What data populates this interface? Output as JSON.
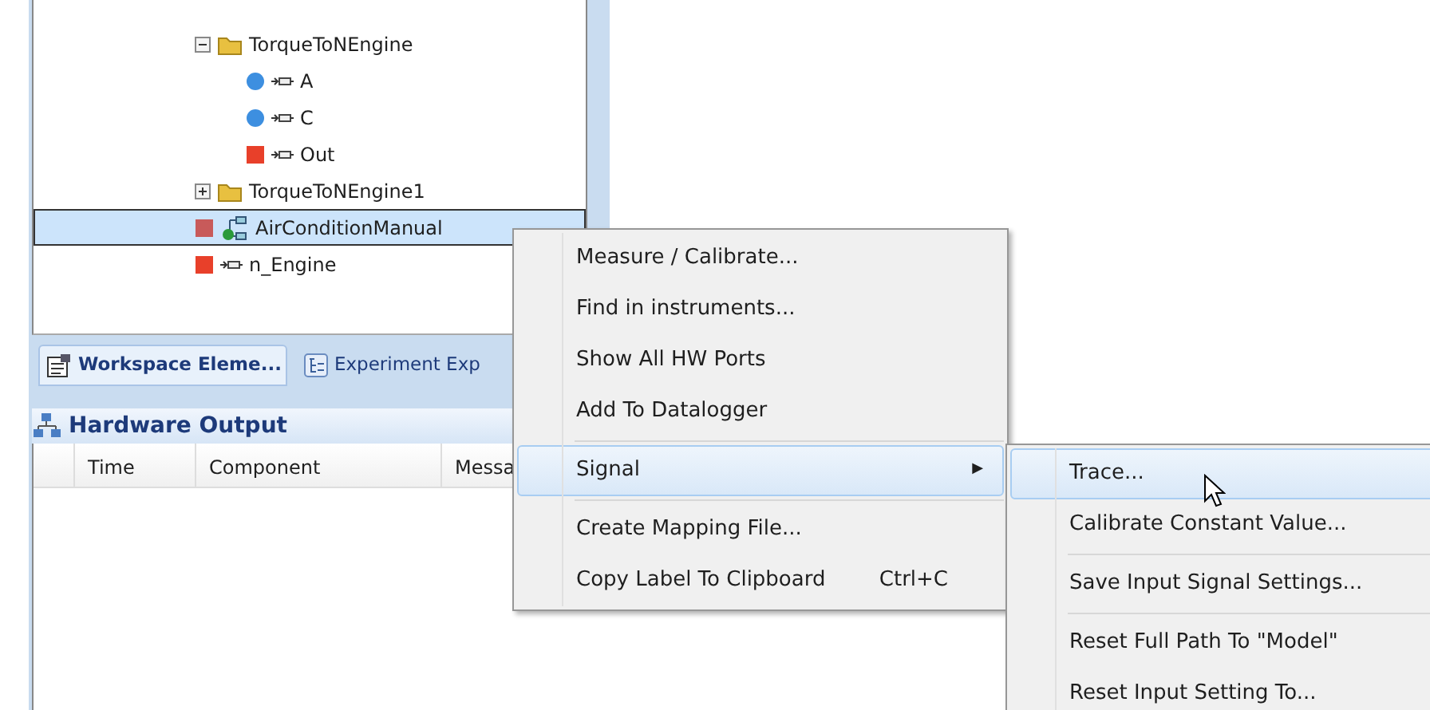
{
  "tree": [
    {
      "label": "TorqueToNEngine",
      "kind": "folder",
      "expanded": true,
      "selected": false,
      "children": [
        {
          "label": "A",
          "kind": "inport",
          "selected": false
        },
        {
          "label": "C",
          "kind": "inport",
          "selected": false
        },
        {
          "label": "Out",
          "kind": "outport",
          "selected": false
        }
      ]
    },
    {
      "label": "TorqueToNEngine1",
      "kind": "folder",
      "expanded": false,
      "selected": false
    },
    {
      "label": "AirConditionManual",
      "kind": "subsystem",
      "selected": true
    },
    {
      "label": "n_Engine",
      "kind": "outport",
      "selected": false
    }
  ],
  "tabs": [
    {
      "label": "Workspace Eleme...",
      "selected": true
    },
    {
      "label": "Experiment Exp",
      "selected": false
    }
  ],
  "panel": {
    "title": "Hardware Output",
    "columns": [
      "",
      "Time",
      "Component",
      "Messa"
    ]
  },
  "context_menu": [
    {
      "kind": "item",
      "label": "Measure / Calibrate...",
      "selected": false
    },
    {
      "kind": "item",
      "label": "Find in instruments...",
      "selected": false
    },
    {
      "kind": "item",
      "label": "Show All HW Ports",
      "selected": false
    },
    {
      "kind": "item",
      "label": "Add To Datalogger",
      "selected": false
    },
    {
      "kind": "separator"
    },
    {
      "kind": "submenu",
      "label": "Signal",
      "arrow": "▶",
      "selected": true
    },
    {
      "kind": "separator"
    },
    {
      "kind": "item",
      "label": "Create Mapping File...",
      "selected": false
    },
    {
      "kind": "item",
      "label": "Copy Label To Clipboard",
      "shortcut": "Ctrl+C",
      "selected": false
    }
  ],
  "submenu": [
    {
      "kind": "item",
      "label": "Trace...",
      "selected": true
    },
    {
      "kind": "item",
      "label": "Calibrate Constant Value...",
      "selected": false
    },
    {
      "kind": "separator"
    },
    {
      "kind": "item",
      "label": "Save Input Signal Settings...",
      "selected": false
    },
    {
      "kind": "separator"
    },
    {
      "kind": "item",
      "label": "Reset Full Path To \"Model\"",
      "selected": false
    },
    {
      "kind": "item",
      "label": "Reset Input Setting To...",
      "selected": false
    }
  ]
}
